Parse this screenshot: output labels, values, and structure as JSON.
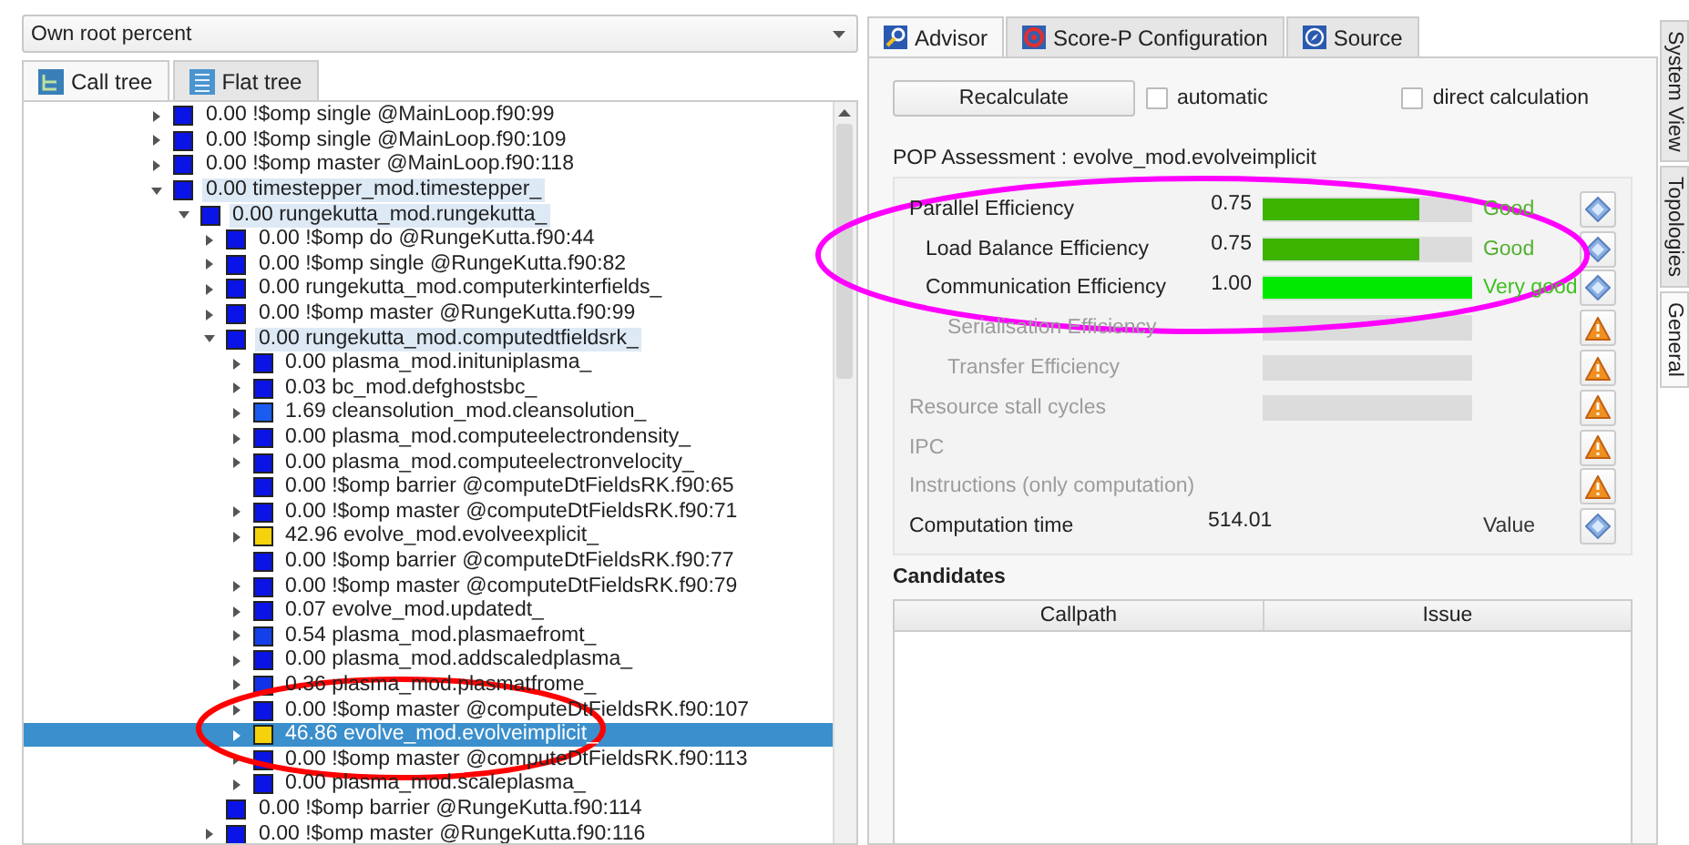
{
  "left_panel": {
    "metric_dropdown": {
      "value": "Own root percent"
    },
    "tabs": [
      {
        "label": "Call tree",
        "selected": true
      },
      {
        "label": "Flat tree",
        "selected": false
      }
    ],
    "tree": [
      {
        "text": "0.00 !$omp single @MainLoop.f90:99",
        "color": "#0a14e6",
        "kind": "branch",
        "expanded": false,
        "selected": false
      },
      {
        "text": "0.00 !$omp single @MainLoop.f90:109",
        "color": "#0a14e6",
        "kind": "branch",
        "expanded": false,
        "selected": false
      },
      {
        "text": "0.00 !$omp master @MainLoop.f90:118",
        "color": "#0a14e6",
        "kind": "branch",
        "expanded": false,
        "selected": false
      },
      {
        "text": "0.00 timestepper_mod.timestepper_",
        "color": "#0a14e6",
        "kind": "branch",
        "expanded": true,
        "selected": false,
        "children": [
          {
            "text": "0.00 rungekutta_mod.rungekutta_",
            "color": "#0a14e6",
            "kind": "branch",
            "expanded": true,
            "selected": false,
            "children": [
              {
                "text": "0.00 !$omp do @RungeKutta.f90:44",
                "color": "#0a14e6",
                "kind": "branch",
                "expanded": false,
                "selected": false
              },
              {
                "text": "0.00 !$omp single @RungeKutta.f90:82",
                "color": "#0a14e6",
                "kind": "branch",
                "expanded": false,
                "selected": false
              },
              {
                "text": "0.00 rungekutta_mod.computerkinterfields_",
                "color": "#0a14e6",
                "kind": "branch",
                "expanded": false,
                "selected": false
              },
              {
                "text": "0.00 !$omp master @RungeKutta.f90:99",
                "color": "#0a14e6",
                "kind": "branch",
                "expanded": false,
                "selected": false
              },
              {
                "text": "0.00 rungekutta_mod.computedtfieldsrk_",
                "color": "#0a14e6",
                "kind": "branch",
                "expanded": true,
                "selected": false,
                "children": [
                  {
                    "text": "0.00 plasma_mod.inituniplasma_",
                    "color": "#0a14e6",
                    "kind": "branch",
                    "expanded": false,
                    "selected": false
                  },
                  {
                    "text": "0.03 bc_mod.defghostsbc_",
                    "color": "#0a14e6",
                    "kind": "branch",
                    "expanded": false,
                    "selected": false
                  },
                  {
                    "text": "1.69 cleansolution_mod.cleansolution_",
                    "color": "#1a5cf0",
                    "kind": "branch",
                    "expanded": false,
                    "selected": false
                  },
                  {
                    "text": "0.00 plasma_mod.computeelectrondensity_",
                    "color": "#0a14e6",
                    "kind": "branch",
                    "expanded": false,
                    "selected": false
                  },
                  {
                    "text": "0.00 plasma_mod.computeelectronvelocity_",
                    "color": "#0a14e6",
                    "kind": "branch",
                    "expanded": false,
                    "selected": false
                  },
                  {
                    "text": "0.00 !$omp barrier @computeDtFieldsRK.f90:65",
                    "color": "#0a14e6",
                    "kind": "leaf",
                    "selected": false
                  },
                  {
                    "text": "0.00 !$omp master @computeDtFieldsRK.f90:71",
                    "color": "#0a14e6",
                    "kind": "branch",
                    "expanded": false,
                    "selected": false
                  },
                  {
                    "text": "42.96 evolve_mod.evolveexplicit_",
                    "color": "#f5d20a",
                    "kind": "branch",
                    "expanded": false,
                    "selected": false
                  },
                  {
                    "text": "0.00 !$omp barrier @computeDtFieldsRK.f90:77",
                    "color": "#0a14e6",
                    "kind": "leaf",
                    "selected": false
                  },
                  {
                    "text": "0.00 !$omp master @computeDtFieldsRK.f90:79",
                    "color": "#0a14e6",
                    "kind": "branch",
                    "expanded": false,
                    "selected": false
                  },
                  {
                    "text": "0.07 evolve_mod.updatedt_",
                    "color": "#0a14e6",
                    "kind": "branch",
                    "expanded": false,
                    "selected": false
                  },
                  {
                    "text": "0.54 plasma_mod.plasmaefromt_",
                    "color": "#1440ea",
                    "kind": "branch",
                    "expanded": false,
                    "selected": false
                  },
                  {
                    "text": "0.00 plasma_mod.addscaledplasma_",
                    "color": "#0a14e6",
                    "kind": "branch",
                    "expanded": false,
                    "selected": false
                  },
                  {
                    "text": "0.36 plasma_mod.plasmatfrome_",
                    "color": "#1232e8",
                    "kind": "branch",
                    "expanded": false,
                    "selected": false
                  },
                  {
                    "text": "0.00 !$omp master @computeDtFieldsRK.f90:107",
                    "color": "#0a14e6",
                    "kind": "branch",
                    "expanded": false,
                    "selected": false
                  },
                  {
                    "text": "46.86 evolve_mod.evolveimplicit_",
                    "color": "#f5d20a",
                    "kind": "branch",
                    "expanded": false,
                    "selected": true
                  },
                  {
                    "text": "0.00 !$omp master @computeDtFieldsRK.f90:113",
                    "color": "#0a14e6",
                    "kind": "branch",
                    "expanded": false,
                    "selected": false
                  },
                  {
                    "text": "0.00 plasma_mod.scaleplasma_",
                    "color": "#0a14e6",
                    "kind": "branch",
                    "expanded": false,
                    "selected": false
                  }
                ]
              },
              {
                "text": "0.00 !$omp barrier @RungeKutta.f90:114",
                "color": "#0a14e6",
                "kind": "leaf",
                "selected": false
              },
              {
                "text": "0.00 !$omp master @RungeKutta.f90:116",
                "color": "#0a14e6",
                "kind": "branch",
                "expanded": false,
                "selected": false
              }
            ]
          }
        ]
      }
    ]
  },
  "right_panel": {
    "tabs": [
      {
        "label": "Advisor",
        "selected": true
      },
      {
        "label": "Score-P Configuration",
        "selected": false
      },
      {
        "label": "Source",
        "selected": false
      }
    ],
    "recalculate_button": "Recalculate",
    "checkboxes": [
      {
        "label": "automatic",
        "checked": false
      },
      {
        "label": "direct calculation",
        "checked": false
      }
    ],
    "assessment_title": "POP Assessment : evolve_mod.evolveimplicit",
    "metrics": [
      {
        "label": "Parallel Efficiency",
        "kind": "bar",
        "disabled": false,
        "value": "0.75",
        "level": 0.75,
        "color": "#3cb400",
        "status": "Good",
        "children": [
          {
            "label": "Load Balance Efficiency",
            "kind": "bar",
            "disabled": false,
            "value": "0.75",
            "level": 0.75,
            "color": "#3cb400",
            "status": "Good"
          },
          {
            "label": "Communication Efficiency",
            "kind": "bar",
            "disabled": false,
            "value": "1.00",
            "level": 1.0,
            "color": "#00ea00",
            "status": "Very good",
            "children": [
              {
                "label": "Serialisation Efficiency",
                "kind": "bar",
                "disabled": true
              },
              {
                "label": "Transfer Efficiency",
                "kind": "bar",
                "disabled": true
              }
            ]
          }
        ]
      },
      {
        "label": "Resource stall cycles",
        "kind": "bar",
        "disabled": true
      },
      {
        "label": "IPC",
        "kind": "plain",
        "disabled": true
      },
      {
        "label": "Instructions (only computation)",
        "kind": "plain",
        "disabled": true
      },
      {
        "label": "Computation time",
        "kind": "plain",
        "disabled": false,
        "value": "514.01",
        "status": "Value"
      }
    ],
    "candidates": {
      "title": "Candidates",
      "columns": [
        "Callpath",
        "Issue"
      ]
    }
  },
  "side_tabs": [
    {
      "label": "System View",
      "selected": false
    },
    {
      "label": "Topologies",
      "selected": false
    },
    {
      "label": "General",
      "selected": true
    }
  ],
  "annotations": [
    {
      "kind": "ellipse",
      "color": "#ff00ff"
    },
    {
      "kind": "ellipse",
      "color": "#ff0000"
    }
  ]
}
